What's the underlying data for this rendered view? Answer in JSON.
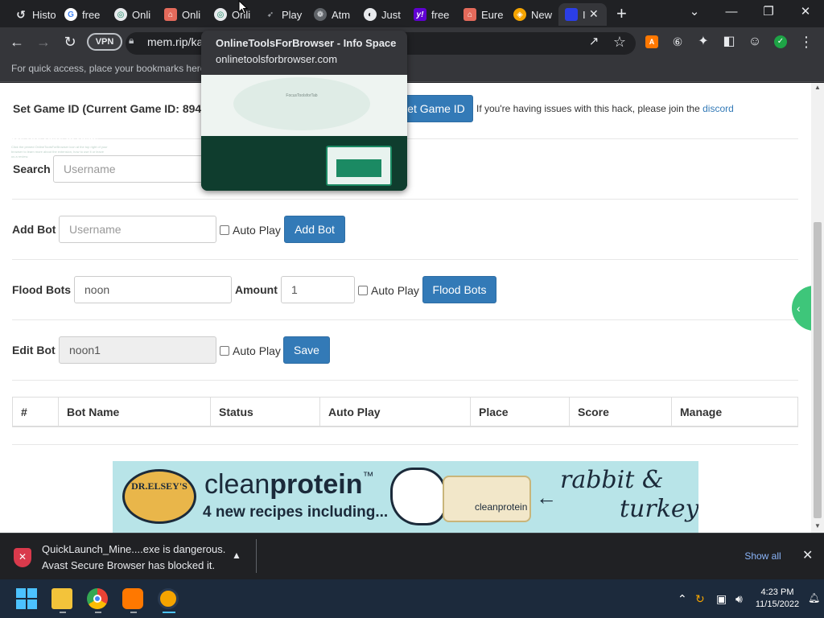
{
  "browser": {
    "tabs": [
      {
        "label": "Histo",
        "icon": "history-icon"
      },
      {
        "label": "free",
        "icon": "google-icon"
      },
      {
        "label": "Onli",
        "icon": "onlinetools-icon"
      },
      {
        "label": "Onli",
        "icon": "shop-icon"
      },
      {
        "label": "Onli",
        "icon": "onlinetools-icon"
      },
      {
        "label": "Play",
        "icon": "rocket-icon"
      },
      {
        "label": "Atm",
        "icon": "atmosphere-icon"
      },
      {
        "label": "Just",
        "icon": "globe-icon"
      },
      {
        "label": "free",
        "icon": "yahoo-icon"
      },
      {
        "label": "Eure",
        "icon": "shop-icon"
      },
      {
        "label": "New",
        "icon": "avast-icon"
      },
      {
        "label": "I",
        "icon": "site-icon"
      }
    ],
    "address": {
      "vpn_label": "VPN",
      "url": "mem.rip/ka"
    },
    "bookmarks_hint": "For quick access, place your bookmarks here",
    "tab_tooltip": {
      "title": "OnlineToolsForBrowser - Info Space",
      "url": "onlinetoolsforbrowser.com",
      "preview_heading": "We Are Here to Help!",
      "preview_top_text": "FocusToolsforTab",
      "preview_body": "Click the pinned OnlineToolsForBrowser icon at the top right of your browser to learn more about the extension, how to use it or leave us a review."
    }
  },
  "page": {
    "game_id": {
      "label": "Set Game ID (Current Game ID: 894",
      "button": "et Game ID",
      "help_text": "If you're having issues with this hack, please join the",
      "help_link": "discord"
    },
    "search": {
      "label": "Search",
      "placeholder": "Username"
    },
    "add_bot": {
      "label": "Add Bot",
      "placeholder": "Username",
      "autoplay_label": "Auto Play",
      "button": "Add Bot"
    },
    "flood_bots": {
      "label": "Flood Bots",
      "name_value": "noon",
      "amount_label": "Amount",
      "amount_value": "1",
      "autoplay_label": "Auto Play",
      "button": "Flood Bots"
    },
    "edit_bot": {
      "label": "Edit Bot",
      "name_value": "noon1",
      "autoplay_label": "Auto Play",
      "button": "Save"
    },
    "table": {
      "headers": [
        "#",
        "Bot Name",
        "Status",
        "Auto Play",
        "Place",
        "Score",
        "Manage"
      ]
    },
    "ad": {
      "logo_text": "DR.ELSEY'S",
      "brand_light": "clean",
      "brand_bold": "protein",
      "brand_tm": "™",
      "subline": "4 new recipes including...",
      "can_label": "cleanprotein",
      "script_line1": "rabbit &",
      "script_line2": "turkey"
    }
  },
  "download_bar": {
    "line1": "QuickLaunch_Mine....exe is dangerous.",
    "line2": "Avast Secure Browser has blocked it.",
    "show_all": "Show all"
  },
  "taskbar": {
    "time": "4:23 PM",
    "date": "11/15/2022"
  },
  "colors": {
    "primary_button": "#337ab7",
    "danger_icon": "#d93a4c",
    "link": "#8ab4f8"
  }
}
